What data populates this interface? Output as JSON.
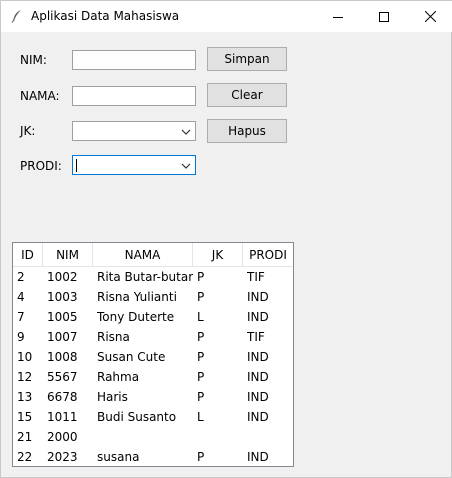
{
  "window": {
    "title": "Aplikasi Data Mahasiswa"
  },
  "form": {
    "nim_label": "NIM:",
    "nama_label": "NAMA:",
    "jk_label": "JK:",
    "prodi_label": "PRODI:",
    "nim_value": "",
    "nama_value": "",
    "jk_value": "",
    "prodi_value": ""
  },
  "buttons": {
    "simpan": "Simpan",
    "clear": "Clear",
    "hapus": "Hapus"
  },
  "table": {
    "headers": [
      "ID",
      "NIM",
      "NAMA",
      "JK",
      "PRODI"
    ],
    "rows": [
      [
        "2",
        "1002",
        "Rita Butar-butar",
        "P",
        "TIF"
      ],
      [
        "4",
        "1003",
        "Risna Yulianti",
        "P",
        "IND"
      ],
      [
        "7",
        "1005",
        "Tony Duterte",
        "L",
        "IND"
      ],
      [
        "9",
        "1007",
        "Risna",
        "P",
        "TIF"
      ],
      [
        "10",
        "1008",
        "Susan Cute",
        "P",
        "IND"
      ],
      [
        "12",
        "5567",
        "Rahma",
        "P",
        "IND"
      ],
      [
        "13",
        "6678",
        "Haris",
        "P",
        "IND"
      ],
      [
        "15",
        "1011",
        "Budi Susanto",
        "L",
        "IND"
      ],
      [
        "21",
        "2000",
        "",
        "",
        ""
      ],
      [
        "22",
        "2023",
        "susana",
        "P",
        "IND"
      ]
    ]
  }
}
